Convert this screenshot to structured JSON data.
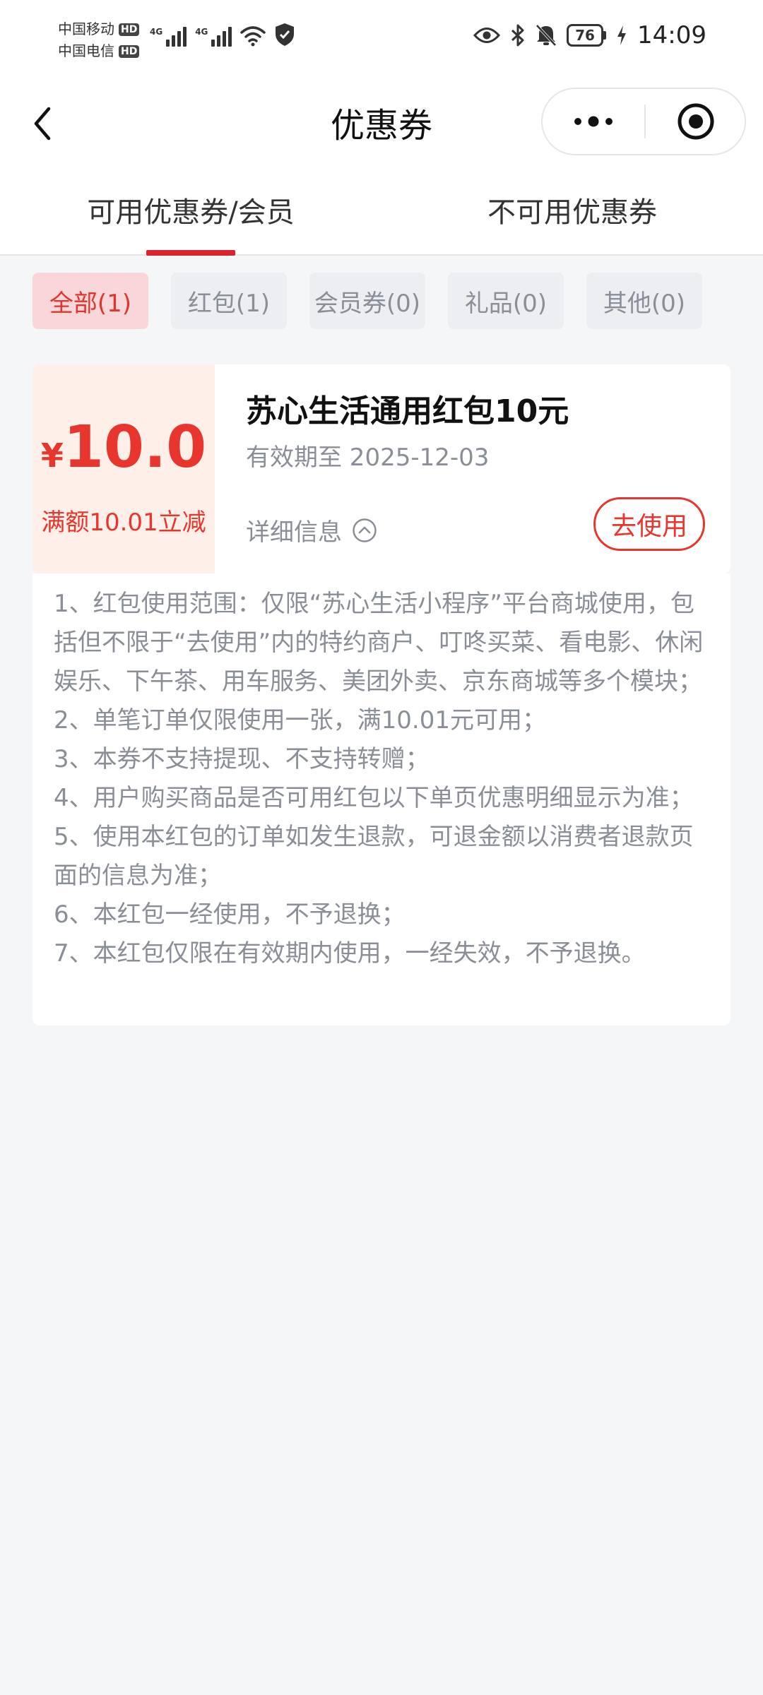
{
  "status_bar": {
    "carrier1": "中国移动",
    "carrier2": "中国电信",
    "hd": "HD",
    "network": "4G",
    "battery": "76",
    "time": "14:09"
  },
  "nav": {
    "title": "优惠券"
  },
  "tabs": [
    {
      "label": "可用优惠券/会员"
    },
    {
      "label": "不可用优惠券"
    }
  ],
  "filters": [
    {
      "label": "全部(1)"
    },
    {
      "label": "红包(1)"
    },
    {
      "label": "会员券(0)"
    },
    {
      "label": "礼品(0)"
    },
    {
      "label": "其他(0)"
    }
  ],
  "coupon": {
    "currency": "¥",
    "amount": "10.0",
    "condition": "满额10.01立减",
    "title": "苏心生活通用红包10元",
    "validity": "有效期至 2025-12-03",
    "detail_label": "详细信息",
    "use_label": "去使用"
  },
  "rules": [
    "1、红包使用范围：仅限“苏心生活小程序”平台商城使用，包括但不限于“去使用”内的特约商户、叮咚买菜、看电影、休闲娱乐、下午茶、用车服务、美团外卖、京东商城等多个模块；",
    "2、单笔订单仅限使用一张，满10.01元可用；",
    "3、本券不支持提现、不支持转赠；",
    "4、用户购买商品是否可用红包以下单页优惠明细显示为准；",
    "5、使用本红包的订单如发生退款，可退金额以消费者退款页面的信息为准；",
    "6、本红包一经使用，不予退换；",
    "7、本红包仅限在有效期内使用，一经失效，不予退换。"
  ],
  "colors": {
    "accent_red": "#e8352e",
    "tab_indicator": "#d9232e",
    "coupon_left_bg": "#ffefe9",
    "chip_active_bg": "#f9d7d9",
    "page_bg": "#f5f6f8"
  }
}
